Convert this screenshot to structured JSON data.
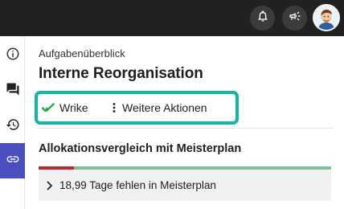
{
  "colors": {
    "topbar": "#212121",
    "accent_highlight": "#14b5a6",
    "active_rail": "#4a4fc0",
    "wrike_check": "#1fae4b",
    "bar_red": "#c0262c",
    "bar_green": "#7fbf9a"
  },
  "header": {
    "icons": [
      "bell-icon",
      "megaphone-icon",
      "user-avatar"
    ]
  },
  "rail": {
    "items": [
      {
        "icon": "info-icon",
        "active": false
      },
      {
        "icon": "chat-icon",
        "active": false
      },
      {
        "icon": "history-icon",
        "active": false
      },
      {
        "icon": "link-icon",
        "active": true
      }
    ]
  },
  "main": {
    "overline": "Aufgabenüberblick",
    "title": "Interne Reorganisation",
    "actions": {
      "wrike_label": "Wrike",
      "more_label": "Weitere Aktionen"
    },
    "section": {
      "title": "Allokationsvergleich mit Meisterplan",
      "allocation_bar": {
        "red_fraction": 0.12,
        "green_fraction": 0.88
      },
      "detail_text": "18,99 Tage fehlen in Meisterplan"
    }
  }
}
